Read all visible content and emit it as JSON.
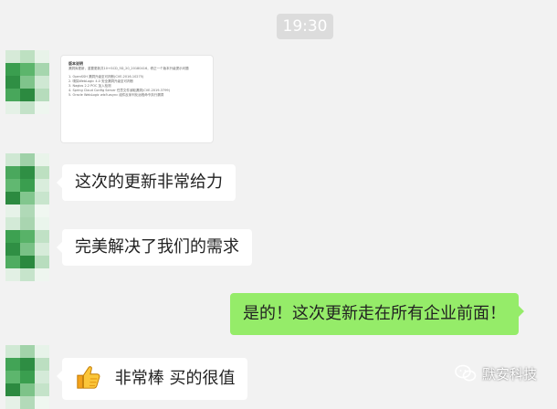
{
  "timestamp": "19:30",
  "doc_card": {
    "title": "版本说明",
    "lines": [
      "漏洞库更新，重要更新共10+GCD_5D_20_20180416，修正一个版本升级提示问题",
      "",
      "1. OpenSSH 漏洞升级至可判断(CVE-2016-10275)",
      "2. 嗅探WebLogic 4.0 安全漏洞升级至可判断",
      "3. Nagios 2.2 POC 加入检测",
      "4. Spring Cloud Config Server 任意文件读取漏洞(CVE-2019-3799)",
      "5. Oracle WebLogic wls9-async 组件反序列化远程命令执行漏洞"
    ]
  },
  "messages": [
    {
      "side": "left",
      "text": "这次的更新非常给力"
    },
    {
      "side": "left",
      "text": "完美解决了我们的需求"
    },
    {
      "side": "right",
      "text": "是的！这次更新走在所有企业前面！"
    },
    {
      "side": "left",
      "text": "非常棒 买的很值",
      "icon": "thumbs-up-icon"
    }
  ],
  "watermark": {
    "text": "默安科技",
    "icon": "wechat-icon"
  },
  "colors": {
    "background": "#f2f2f2",
    "bubble_right": "#95ec69",
    "bubble_left": "#ffffff",
    "avatar_green": "#3aa655"
  }
}
